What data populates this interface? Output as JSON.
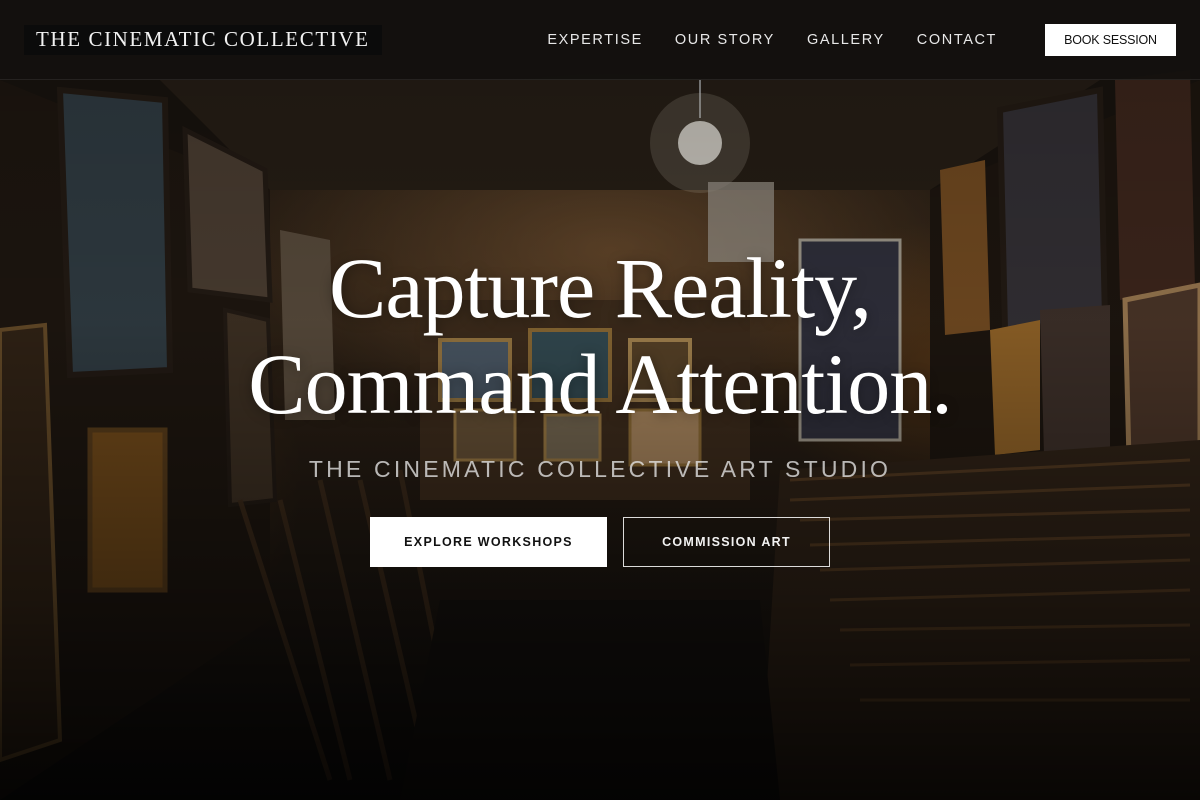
{
  "header": {
    "logo": "THE CINEMATIC COLLECTIVE",
    "nav": [
      "EXPERTISE",
      "OUR STORY",
      "GALLERY",
      "CONTACT"
    ],
    "book_label": "BOOK SESSION"
  },
  "hero": {
    "headline_line1": "Capture Reality,",
    "headline_line2": "Command Attention.",
    "subtitle": "THE CINEMATIC COLLECTIVE ART STUDIO",
    "primary_cta": "EXPLORE WORKSHOPS",
    "secondary_cta": "COMMISSION ART",
    "background_image": "art-studio-storage-room"
  },
  "colors": {
    "header_bg": "#121010",
    "button_bg": "#ffffff",
    "text": "#ffffff"
  }
}
